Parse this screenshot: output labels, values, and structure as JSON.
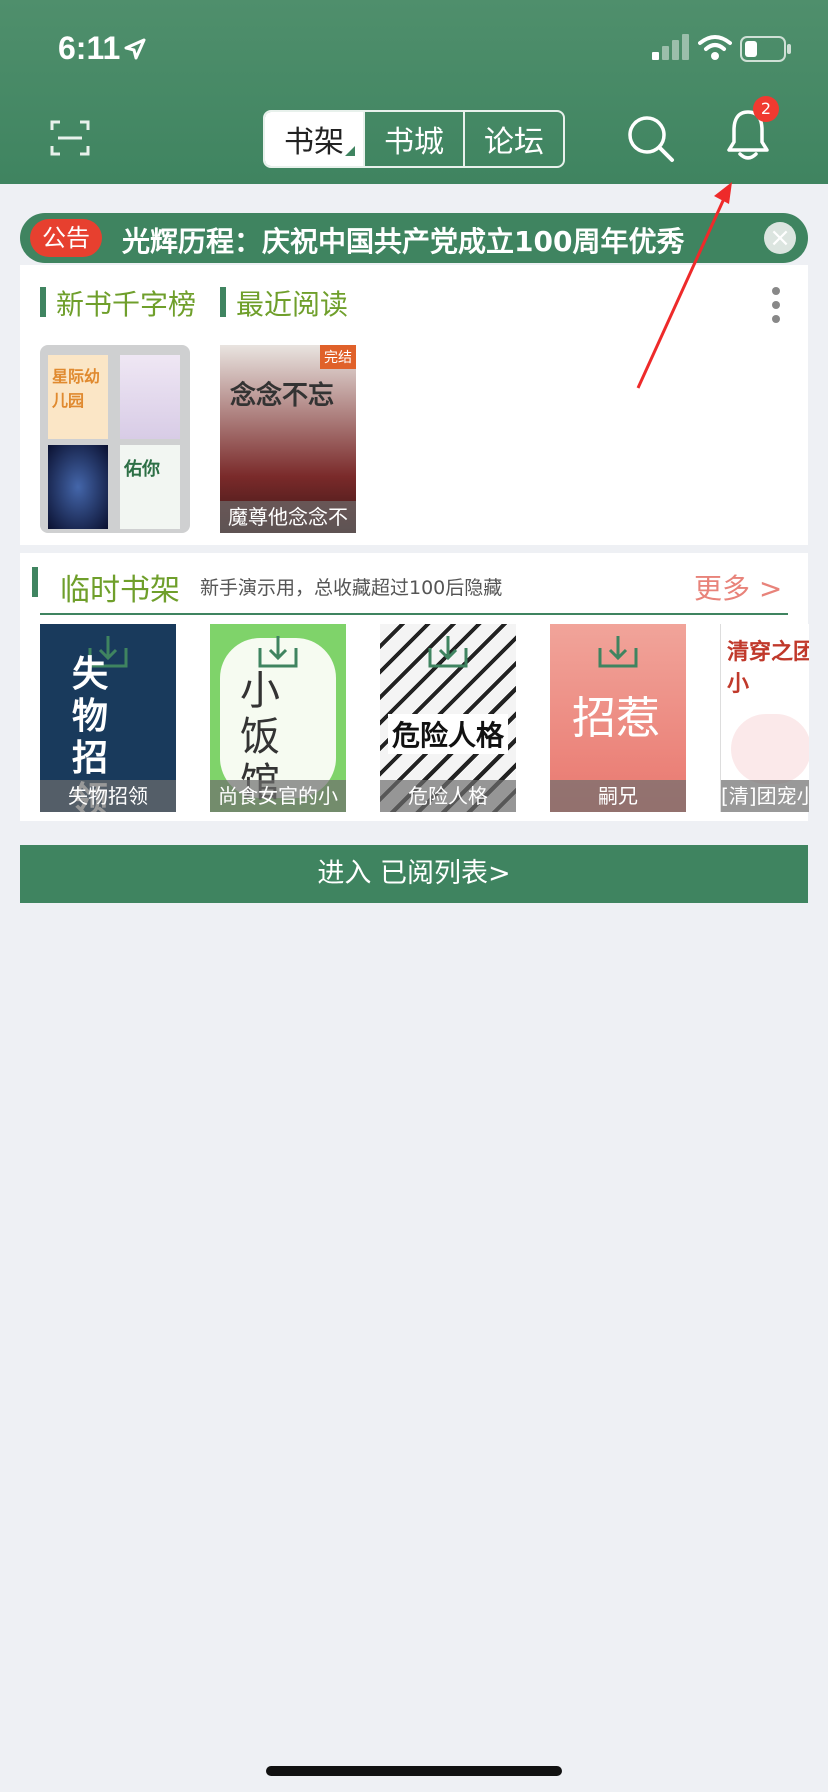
{
  "status_bar": {
    "time": "6:11"
  },
  "header": {
    "tabs": [
      {
        "label": "书架"
      },
      {
        "label": "书城"
      },
      {
        "label": "论坛"
      }
    ],
    "notification_count": "2"
  },
  "notice": {
    "tag": "公告",
    "text": "光辉历程：庆祝中国共产党成立100周年优秀"
  },
  "recent": {
    "sections": [
      {
        "label": "新书千字榜"
      },
      {
        "label": "最近阅读"
      }
    ],
    "folder_books": [
      "星际幼儿园",
      "",
      "",
      "佑你"
    ],
    "books": [
      {
        "title": "魔尊他念念不",
        "cover_text": "念念不忘",
        "badge": "完结"
      }
    ]
  },
  "shelf": {
    "title": "临时书架",
    "hint": "新手演示用，总收藏超过100后隐藏",
    "more": "更多 >",
    "books": [
      {
        "title": "失物招领",
        "cover_text": "失物招领",
        "bg": "#193a5c"
      },
      {
        "title": "尚食女官的小",
        "cover_text": "小饭馆",
        "bg": "#7fd36a"
      },
      {
        "title": "危险人格",
        "cover_text": "危险人格",
        "bg": "#f4f4f4"
      },
      {
        "title": "嗣兄",
        "cover_text": "招惹",
        "bg": "#e9786f"
      },
      {
        "title": "[清]团宠小",
        "cover_text": "清穿之团宠小",
        "bg": "#ffffff"
      }
    ]
  },
  "read_list_button": "进入 已阅列表>",
  "colors": {
    "brand_green": "#3f8460",
    "accent_red": "#e7402f",
    "label_green": "#6f9f2b",
    "more_pink": "#e8837a"
  }
}
